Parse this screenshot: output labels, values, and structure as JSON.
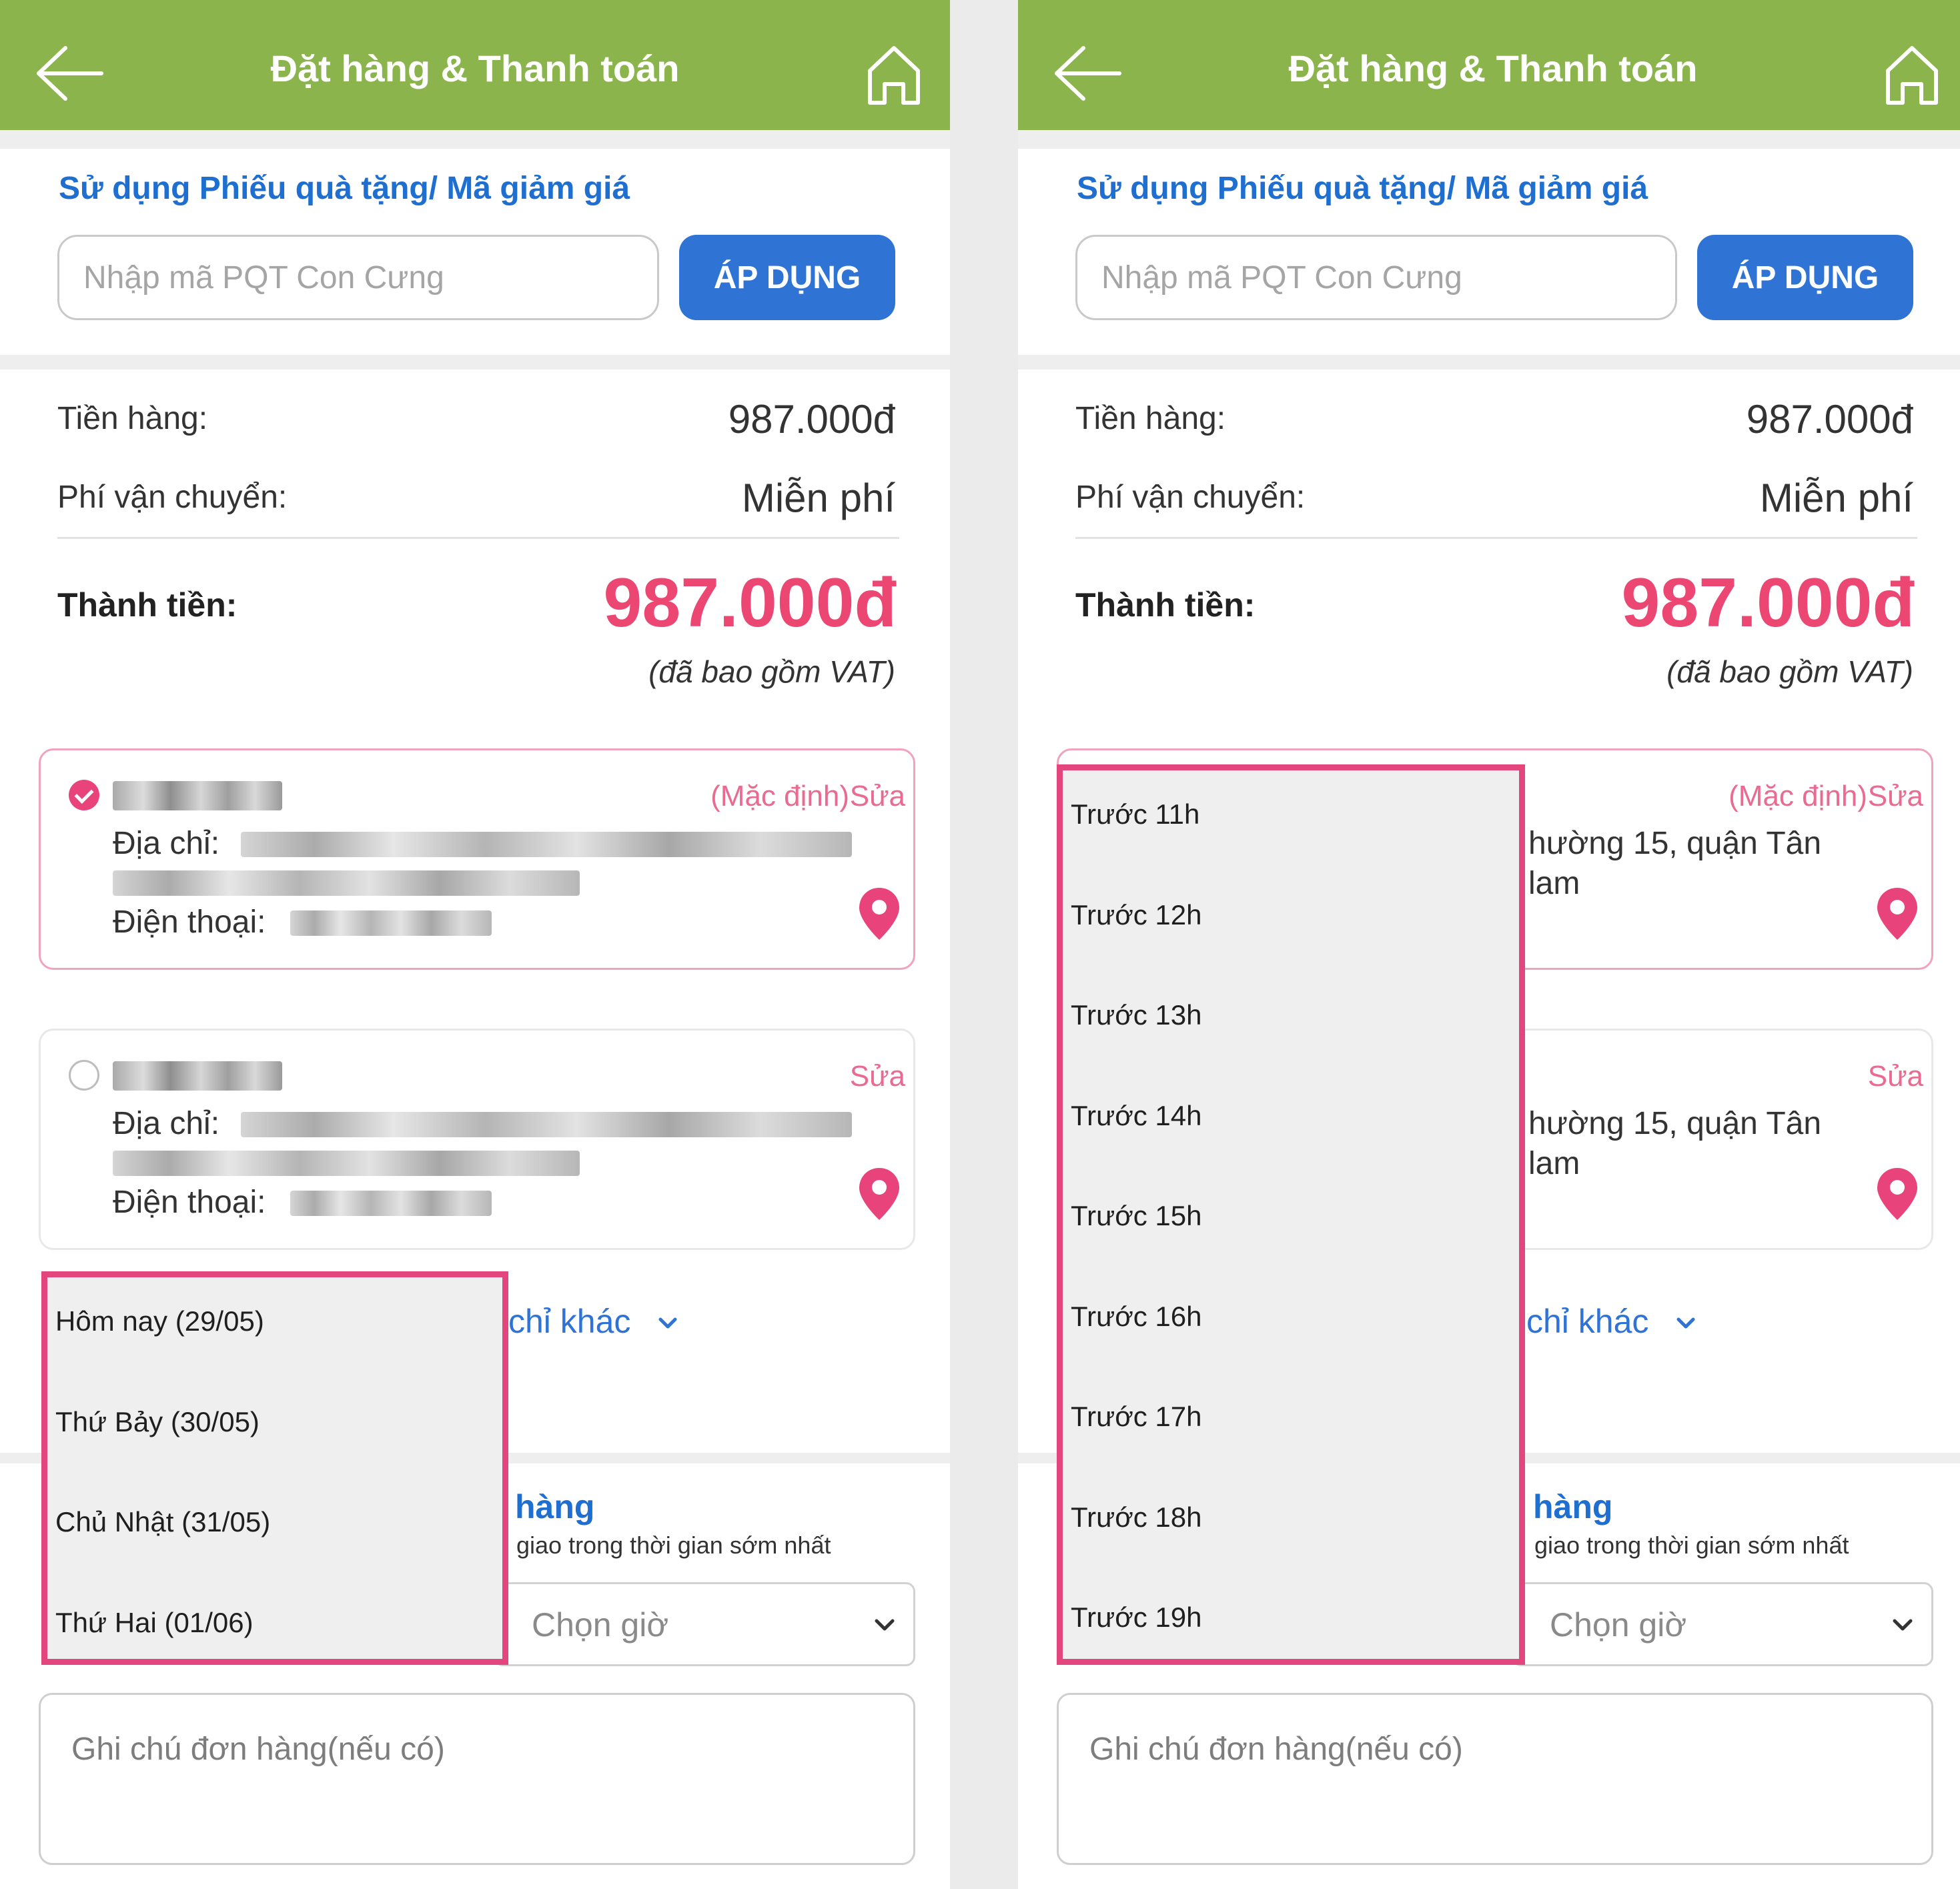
{
  "header": {
    "title": "Đặt hàng & Thanh toán"
  },
  "voucher": {
    "title": "Sử dụng Phiếu quà tặng/ Mã giảm giá",
    "placeholder": "Nhập mã PQT Con Cưng",
    "apply_label": "ÁP DỤNG"
  },
  "summary": {
    "subtotal_label": "Tiền hàng:",
    "subtotal_value": "987.000đ",
    "shipping_label": "Phí vận chuyển:",
    "shipping_value": "Miễn phí",
    "total_label": "Thành tiền:",
    "total_value": "987.000đ",
    "vat_note": "(đã bao gồm VAT)"
  },
  "addresses": [
    {
      "default_tag": "(Mặc định)",
      "edit": "Sửa",
      "address_label": "Địa chỉ:",
      "phone_label": "Điện thoại:",
      "selected": true
    },
    {
      "edit": "Sửa",
      "address_label": "Địa chỉ:",
      "phone_label": "Điện thoại:",
      "selected": false
    }
  ],
  "other_address_link": "chỉ khác",
  "address_partial": {
    "line1": "hường 15, quận Tân",
    "line2": "lam"
  },
  "delivery": {
    "heading_partial": "hàng",
    "sub_partial": "giao trong thời gian sớm nhất",
    "time_placeholder": "Chọn giờ"
  },
  "note": {
    "placeholder": "Ghi chú đơn hàng(nếu có)"
  },
  "date_options": [
    "Hôm nay (29/05)",
    "Thứ Bảy (30/05)",
    "Chủ Nhật (31/05)",
    "Thứ Hai (01/06)"
  ],
  "time_options": [
    "Trước 11h",
    "Trước 12h",
    "Trước 13h",
    "Trước 14h",
    "Trước 15h",
    "Trước 16h",
    "Trước 17h",
    "Trước 18h",
    "Trước 19h"
  ],
  "colors": {
    "header_bg": "#8bb54c",
    "link_blue": "#1f6fd1",
    "button_blue": "#2f73d4",
    "price_pink": "#ec4673",
    "dropdown_border": "#e2467d"
  },
  "icons": [
    "back-arrow-icon",
    "home-icon",
    "check-circle-icon",
    "location-pin-icon",
    "chevron-down-icon"
  ]
}
